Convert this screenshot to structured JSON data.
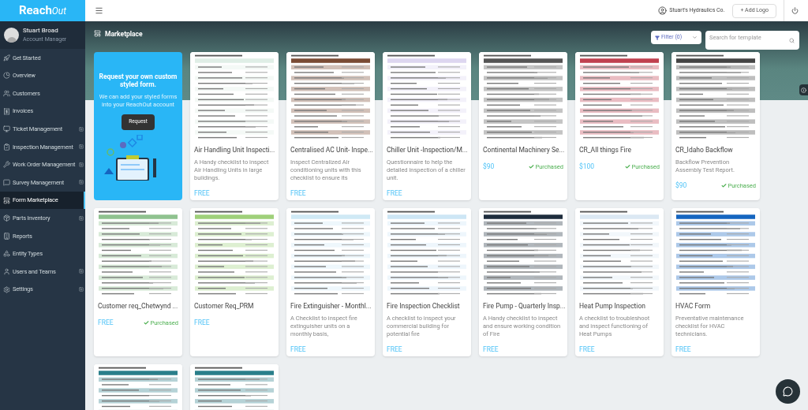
{
  "brand": {
    "logo": "Reach",
    "logo_tail": "Out"
  },
  "user": {
    "name": "Stuart Broad",
    "role": "Account Manager"
  },
  "sidebar": {
    "items": [
      {
        "label": "Get Started",
        "expandable": false,
        "selected": false
      },
      {
        "label": "Overview",
        "expandable": false,
        "selected": false
      },
      {
        "label": "Customers",
        "expandable": false,
        "selected": false
      },
      {
        "label": "Invoices",
        "expandable": false,
        "selected": false
      },
      {
        "label": "Ticket Management",
        "expandable": true,
        "selected": false
      },
      {
        "label": "Inspection Management",
        "expandable": true,
        "selected": false
      },
      {
        "label": "Work Order Management",
        "expandable": true,
        "selected": false
      },
      {
        "label": "Survey Management",
        "expandable": true,
        "selected": false
      },
      {
        "label": "Form Marketplace",
        "expandable": false,
        "selected": true
      },
      {
        "label": "Parts Inventory",
        "expandable": true,
        "selected": false
      },
      {
        "label": "Reports",
        "expandable": false,
        "selected": false
      },
      {
        "label": "Entity Types",
        "expandable": false,
        "selected": false
      },
      {
        "label": "Users and Teams",
        "expandable": true,
        "selected": false
      },
      {
        "label": "Settings",
        "expandable": true,
        "selected": false
      }
    ]
  },
  "topbar": {
    "company": "Stuart's Hydraulics Co.",
    "add_logo": "+ Add Logo"
  },
  "page": {
    "title": "Marketplace",
    "filter": "Filter (0)",
    "search": {
      "placeholder": "Search for template"
    }
  },
  "promo": {
    "title": "Request your own custom styled form.",
    "text": "We can add your styled forms into your ReachOut account",
    "button": "Request"
  },
  "cards": [
    {
      "kind": "template",
      "title": "Air Handling Unit Inspecti...",
      "description": "A Handy checklist to inspect Air Handling Units in large buildings.",
      "price": "FREE",
      "purchased": false
    },
    {
      "kind": "template",
      "title": "Centralised AC Unit- Inspe...",
      "description": "Inspect Centralized Air conditioning units with this checklist to ensure its",
      "price": "FREE",
      "purchased": false
    },
    {
      "kind": "template",
      "title": "Chiller Unit -Inspection/M...",
      "description": "Questionnaire to help the detailed inspection of a chiller unit.",
      "price": "FREE",
      "purchased": false
    },
    {
      "kind": "template",
      "title": "Continental Machinery Se...",
      "price": "$90",
      "purchased": true,
      "purchased_label": "Purchased"
    },
    {
      "kind": "template",
      "title": "CR_All things Fire",
      "price": "$100",
      "purchased": true,
      "purchased_label": "Purchased"
    },
    {
      "kind": "template",
      "title": "CR_Idaho Backflow",
      "description": "Backflow Prevention Assembly Test Report.",
      "price": "$90",
      "purchased": true,
      "purchased_label": "Purchased"
    },
    {
      "kind": "template",
      "title": "Customer req_Chetwynd ...",
      "price": "FREE",
      "purchased": true,
      "purchased_label": "Purchased"
    },
    {
      "kind": "template",
      "title": "Customer Req_PRM",
      "price": "FREE",
      "purchased": false
    },
    {
      "kind": "template",
      "title": "Fire Extinguisher - Monthl...",
      "description": "A Checklist to inspect fire extinguisher units on a monthly basis,",
      "price": "FREE",
      "purchased": false
    },
    {
      "kind": "template",
      "title": "Fire Inspection Checklist",
      "description": "A checklist to inspect your commercial building for potential fire",
      "price": "FREE",
      "purchased": false
    },
    {
      "kind": "template",
      "title": "Fire Pump - Quarterly Insp...",
      "description": "A Handy checklist to inspect and ensure working condition of Fire",
      "price": "FREE",
      "purchased": false
    },
    {
      "kind": "template",
      "title": "Heat Pump Inspection",
      "description": "A checklist to troubleshoot and inspect functioning of Heat Pumps",
      "price": "FREE",
      "purchased": false
    },
    {
      "kind": "template",
      "title": "HVAC Form",
      "description": "Preventative maintenance checklist for HVAC technicians.",
      "price": "FREE",
      "purchased": false
    },
    {
      "kind": "partial"
    },
    {
      "kind": "partial"
    }
  ]
}
